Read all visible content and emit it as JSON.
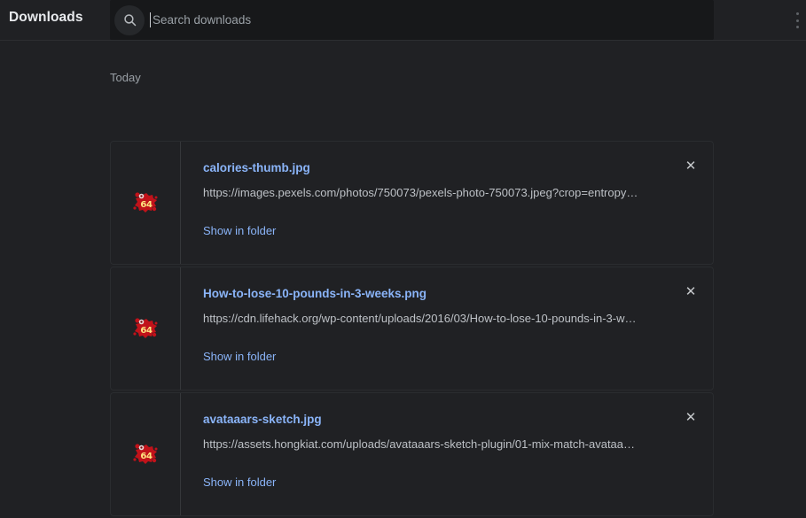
{
  "toolbar": {
    "page_title": "Downloads",
    "search": {
      "placeholder": "Search downloads",
      "value": "",
      "icon": "search-icon"
    },
    "overflow_icon": "more-vertical-icon"
  },
  "content": {
    "date_header": "Today",
    "downloads": [
      {
        "file_name": "calories-thumb.jpg",
        "url": "https://images.pexels.com/photos/750073/pexels-photo-750073.jpeg?crop=entropy…",
        "action_label": "Show in folder",
        "close_icon": "close-icon",
        "thumb_icon": "red-splat-64-icon",
        "thumb_badge": "64"
      },
      {
        "file_name": "How-to-lose-10-pounds-in-3-weeks.png",
        "url": "https://cdn.lifehack.org/wp-content/uploads/2016/03/How-to-lose-10-pounds-in-3-w…",
        "action_label": "Show in folder",
        "close_icon": "close-icon",
        "thumb_icon": "red-splat-64-icon",
        "thumb_badge": "64"
      },
      {
        "file_name": "avataaars-sketch.jpg",
        "url": "https://assets.hongkiat.com/uploads/avataaars-sketch-plugin/01-mix-match-avataa…",
        "action_label": "Show in folder",
        "close_icon": "close-icon",
        "thumb_icon": "red-splat-64-icon",
        "thumb_badge": "64"
      }
    ]
  },
  "colors": {
    "background": "#202124",
    "search_field": "#17181a",
    "link": "#8ab4f8",
    "url_text": "#bdc1c6",
    "muted_text": "#9aa0a6",
    "card_border": "#2a2c2f",
    "splat_red": "#c1121a",
    "badge_yellow": "#ffe680"
  }
}
